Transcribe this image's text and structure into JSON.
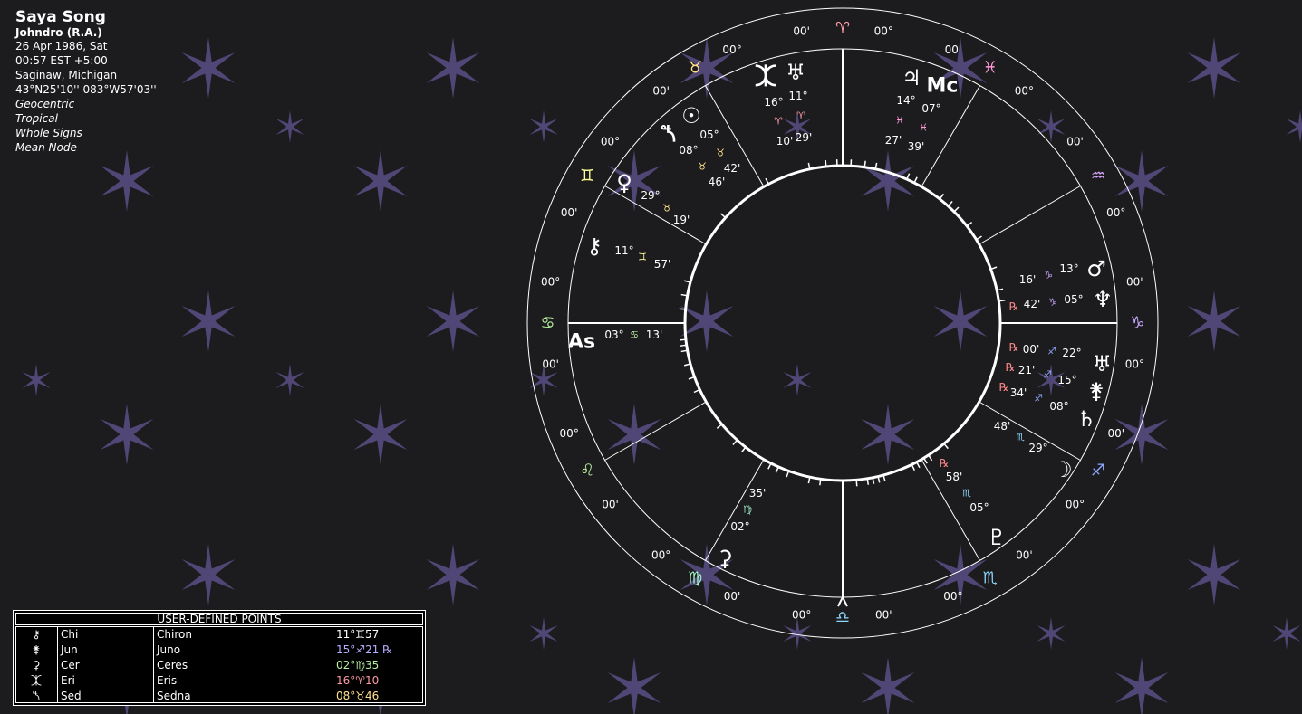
{
  "header": {
    "name": "Saya Song",
    "house_method": "Johndro (R.A.)",
    "date": "26 Apr 1986, Sat",
    "time": "00:57  EST +5:00",
    "place": "Saginaw, Michigan",
    "coords": "43°N25'10'' 083°W57'03''",
    "options": [
      "Geocentric",
      "Tropical",
      "Whole Signs",
      "Mean Node"
    ]
  },
  "udp_table": {
    "title": "USER-DEFINED POINTS",
    "rows": [
      {
        "glyph": "⚷",
        "abbr": "Chi",
        "name": "Chiron",
        "position": "11°♊57",
        "color": "#ffffff"
      },
      {
        "glyph": "⚵",
        "abbr": "Jun",
        "name": "Juno",
        "position": "15°♐21 ℞",
        "color": "#b6b0ff"
      },
      {
        "glyph": "⚳",
        "abbr": "Cer",
        "name": "Ceres",
        "position": "02°♍35",
        "color": "#b8f0a0"
      },
      {
        "glyph": "⯰",
        "abbr": "Eri",
        "name": "Eris",
        "position": "16°♈10",
        "color": "#ff9ba5"
      },
      {
        "glyph": "⯲",
        "abbr": "Sed",
        "name": "Sedna",
        "position": "08°♉46",
        "color": "#ffe08a"
      }
    ]
  },
  "wheel": {
    "signs": [
      {
        "glyph": "♈",
        "color": "#ff9ba5",
        "cusp_left": "00°",
        "cusp_right": "00'"
      },
      {
        "glyph": "♉",
        "color": "#ffe08a",
        "cusp_left": "00°",
        "cusp_right": "00'"
      },
      {
        "glyph": "♊",
        "color": "#ffff99",
        "cusp_left": "00°",
        "cusp_right": "00'"
      },
      {
        "glyph": "♋",
        "color": "#b8f0a0",
        "cusp_left": "00°",
        "cusp_right": "00'"
      },
      {
        "glyph": "♌",
        "color": "#b8f0a0",
        "cusp_left": "00°",
        "cusp_right": "00'"
      },
      {
        "glyph": "♍",
        "color": "#a0f0c8",
        "cusp_left": "00°",
        "cusp_right": "00'"
      },
      {
        "glyph": "♎",
        "color": "#8ed8ff",
        "cusp_left": "00°",
        "cusp_right": "00'"
      },
      {
        "glyph": "♏",
        "color": "#8ed8ff",
        "cusp_left": "00°",
        "cusp_right": "00'"
      },
      {
        "glyph": "♐",
        "color": "#8fa8ff",
        "cusp_left": "00°",
        "cusp_right": "00'"
      },
      {
        "glyph": "♑",
        "color": "#c8a8ff",
        "cusp_left": "00°",
        "cusp_right": "00'"
      },
      {
        "glyph": "♒",
        "color": "#d8a8ff",
        "cusp_left": "00°",
        "cusp_right": "00'"
      },
      {
        "glyph": "♓",
        "color": "#ff9bd8",
        "cusp_left": "00°",
        "cusp_right": "00'"
      }
    ],
    "angles": {
      "asc": "As",
      "mc": "Mc",
      "asc_deg": "03°",
      "asc_sign": "♋",
      "asc_min": "13'",
      "mc_deg": "07°",
      "mc_sign": "♓",
      "mc_min": "39'"
    },
    "retrograde_symbol": "℞",
    "planets": [
      {
        "name": "Eris",
        "glyph": "⯰",
        "deg": "16°",
        "sign": "♈",
        "min": "10'",
        "sign_color": "#ff9ba5"
      },
      {
        "name": "Uranus-top",
        "glyph": "♅",
        "deg": "11°",
        "sign": "♈",
        "min": "29'",
        "sign_color": "#ff9ba5"
      },
      {
        "name": "Jupiter",
        "glyph": "♃",
        "deg": "14°",
        "sign": "♓",
        "min": "27'",
        "sign_color": "#ff9bd8"
      },
      {
        "name": "Sun",
        "glyph": "☉",
        "deg": "05°",
        "sign": "♉",
        "min": "42'",
        "sign_color": "#ffe08a"
      },
      {
        "name": "Sedna",
        "glyph": "⯲",
        "deg": "08°",
        "sign": "♉",
        "min": "46'",
        "sign_color": "#ffe08a"
      },
      {
        "name": "Venus",
        "glyph": "♀",
        "deg": "29°",
        "sign": "♉",
        "min": "19'",
        "sign_color": "#ffe08a"
      },
      {
        "name": "Chiron",
        "glyph": "⚷",
        "deg": "11°",
        "sign": "♊",
        "min": "57'",
        "sign_color": "#ffff99"
      },
      {
        "name": "Mars",
        "glyph": "♂",
        "deg": "13°",
        "sign": "♑",
        "min": "16'",
        "sign_color": "#c8a8ff"
      },
      {
        "name": "Neptune",
        "glyph": "♆",
        "deg": "05°",
        "sign": "♑",
        "min": "42'",
        "sign_color": "#c8a8ff",
        "retro": true
      },
      {
        "name": "Uranus",
        "glyph": "♅",
        "deg": "22°",
        "sign": "♐",
        "min": "00'",
        "sign_color": "#8fa8ff",
        "retro": true
      },
      {
        "name": "Juno",
        "glyph": "⚵",
        "deg": "15°",
        "sign": "♐",
        "min": "21'",
        "sign_color": "#8fa8ff",
        "retro": true
      },
      {
        "name": "Saturn",
        "glyph": "♄",
        "deg": "08°",
        "sign": "♐",
        "min": "34'",
        "sign_color": "#8fa8ff",
        "retro": true
      },
      {
        "name": "Moon",
        "glyph": "☽",
        "deg": "29°",
        "sign": "♏",
        "min": "48'",
        "sign_color": "#8ed8ff"
      },
      {
        "name": "Pluto",
        "glyph": "♇",
        "deg": "05°",
        "sign": "♏",
        "min": "58'",
        "sign_color": "#8ed8ff",
        "retro": true
      },
      {
        "name": "Ceres",
        "glyph": "⚳",
        "deg": "02°",
        "sign": "♍",
        "min": "35'",
        "sign_color": "#a0f0c8"
      }
    ]
  },
  "colors": {
    "background": "#1c1b1e",
    "star": "#5a4f86",
    "line": "#ffffff",
    "retro": "#ff8c8c"
  }
}
